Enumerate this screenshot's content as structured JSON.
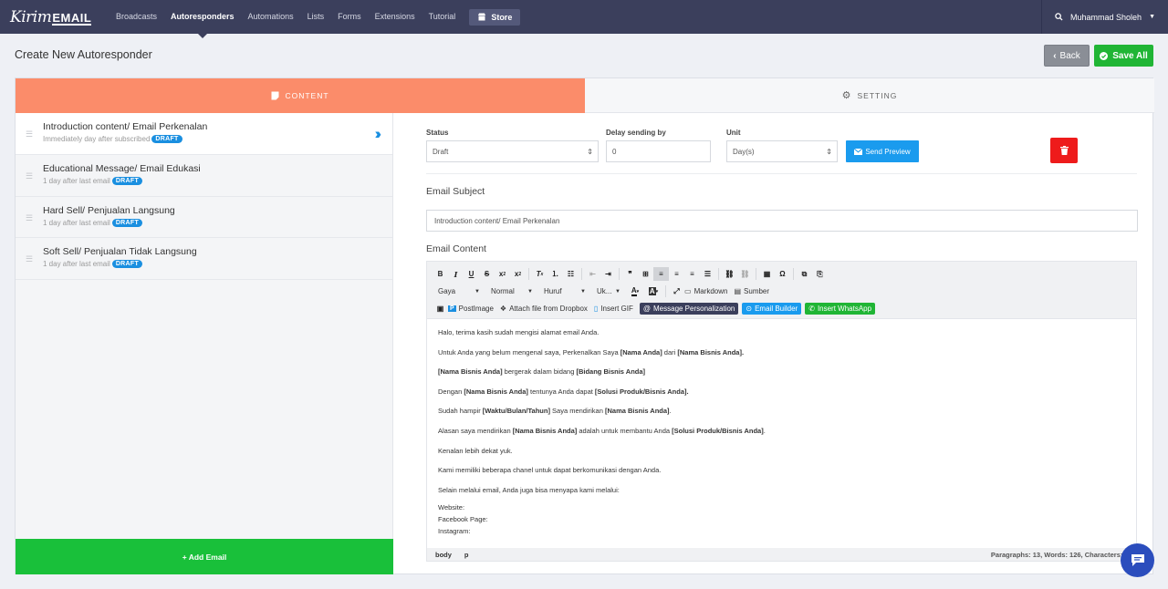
{
  "brand": {
    "logo_part1": "Kirim",
    "logo_part2": "EMAIL"
  },
  "nav": {
    "items": [
      {
        "label": "Broadcasts",
        "active": false
      },
      {
        "label": "Autoresponders",
        "active": true
      },
      {
        "label": "Automations",
        "active": false
      },
      {
        "label": "Lists",
        "active": false
      },
      {
        "label": "Forms",
        "active": false
      },
      {
        "label": "Extensions",
        "active": false
      },
      {
        "label": "Tutorial",
        "active": false
      }
    ],
    "store_label": "Store",
    "user_name": "Muhammad Sholeh"
  },
  "page": {
    "title": "Create New Autoresponder",
    "back_label": "Back",
    "save_all_label": "Save All"
  },
  "tabs": {
    "content": "CONTENT",
    "setting": "SETTING"
  },
  "emails": [
    {
      "title": "Introduction content/ Email Perkenalan",
      "subtitle": "Immediately day after subscribed",
      "badge": "DRAFT"
    },
    {
      "title": "Educational Message/ Email Edukasi",
      "subtitle": "1 day after last email",
      "badge": "DRAFT"
    },
    {
      "title": "Hard Sell/ Penjualan Langsung",
      "subtitle": "1 day after last email",
      "badge": "DRAFT"
    },
    {
      "title": "Soft Sell/ Penjualan Tidak Langsung",
      "subtitle": "1 day after last email",
      "badge": "DRAFT"
    }
  ],
  "add_email_label": "+ Add Email",
  "form": {
    "status_label": "Status",
    "status_value": "Draft",
    "delay_label": "Delay sending by",
    "delay_value": "0",
    "unit_label": "Unit",
    "unit_value": "Day(s)",
    "send_preview_label": "Send Preview",
    "subject_label": "Email Subject",
    "subject_value": "Introduction content/ Email Perkenalan",
    "content_label": "Email Content"
  },
  "toolbar": {
    "style_combo": "Gaya",
    "format_combo": "Normal",
    "font_combo": "Huruf",
    "size_combo": "Uk...",
    "markdown": "Markdown",
    "source": "Sumber",
    "postimage": "PostImage",
    "dropbox": "Attach file from Dropbox",
    "gif": "Insert GIF",
    "personalization": "Message Personalization",
    "builder": "Email Builder",
    "whatsapp": "Insert WhatsApp"
  },
  "editor": {
    "p1": "Halo, terima kasih sudah mengisi alamat email Anda.",
    "p2a": "Untuk Anda yang belum mengenal saya, Perkenalkan Saya ",
    "p2b": "[Nama Anda]",
    "p2c": " dari ",
    "p2d": "[Nama Bisnis Anda].",
    "p3a": "[Nama Bisnis Anda]",
    "p3b": " bergerak dalam bidang ",
    "p3c": "[Bidang Bisnis Anda]",
    "p4a": "Dengan ",
    "p4b": "[Nama Bisnis Anda]",
    "p4c": " tentunya Anda dapat ",
    "p4d": "[Solusi Produk/Bisnis Anda].",
    "p5a": "Sudah hampir ",
    "p5b": "[Waktu/Bulan/Tahun]",
    "p5c": " Saya mendirikan ",
    "p5d": "[Nama Bisnis Anda]",
    "p5e": ".",
    "p6a": "Alasan saya mendirikan ",
    "p6b": "[Nama Bisnis Anda]",
    "p6c": " adalah untuk membantu Anda ",
    "p6d": "[Solusi Produk/Bisnis Anda]",
    "p6e": ".",
    "p7": "Kenalan lebih dekat yuk.",
    "p8": "Kami memiliki beberapa chanel untuk dapat berkomunikasi dengan Anda.",
    "p9": "Selain melalui email, Anda juga bisa menyapa kami melalui:",
    "l1": "Website:",
    "l2": "Facebook Page:",
    "l3": "Instagram:"
  },
  "statusbar": {
    "path1": "body",
    "path2": "p",
    "counts": "Paragraphs: 13, Words: 126, Characters: 759"
  },
  "colors": {
    "nav_bg": "#3b3f5c",
    "content_tab": "#fb8c6a",
    "save_green": "#20b535",
    "add_green": "#19c03a",
    "badge_blue": "#1a8fe0",
    "delete_red": "#ee1b1b"
  }
}
